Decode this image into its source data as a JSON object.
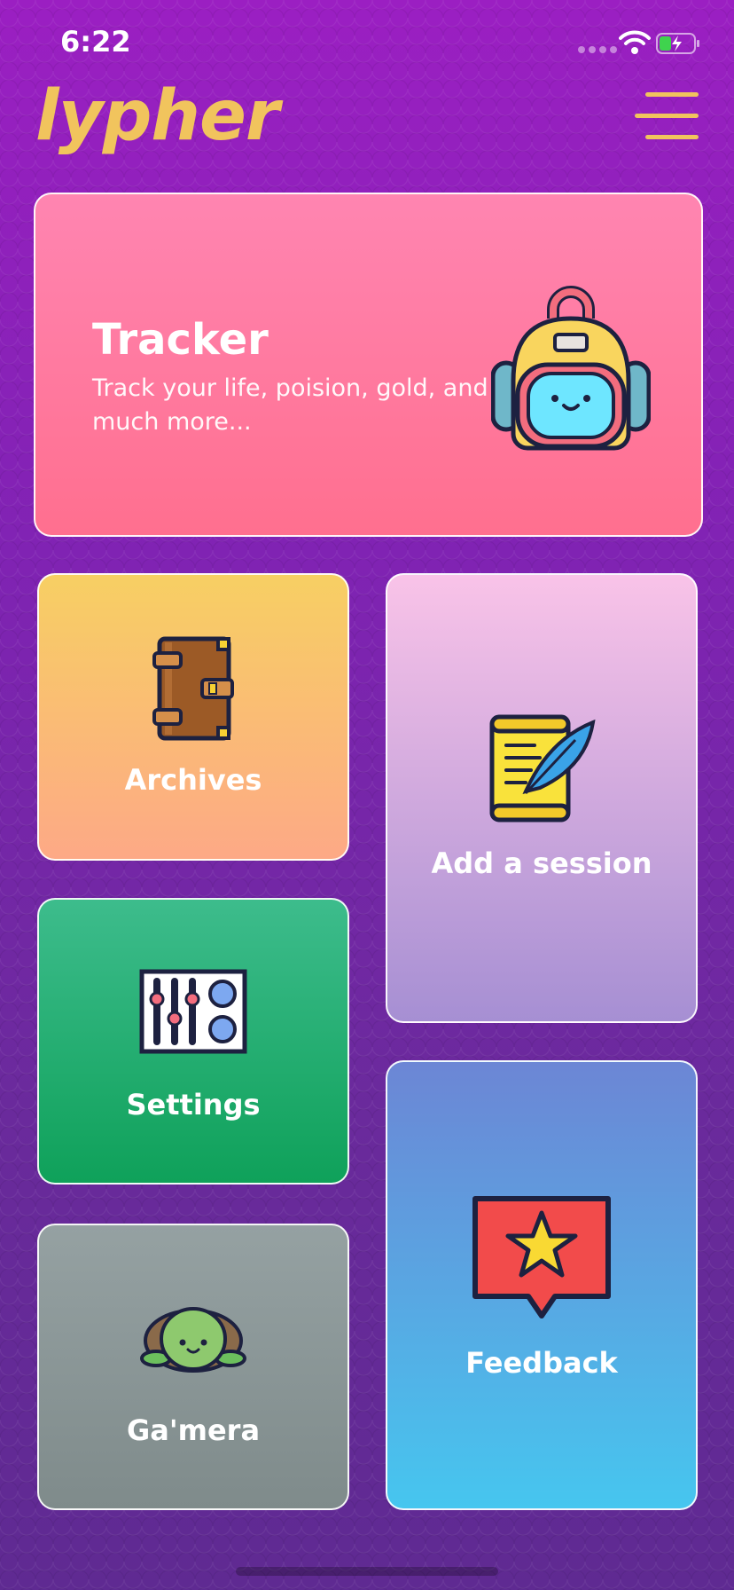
{
  "status_bar": {
    "time": "6:22"
  },
  "header": {
    "logo": "lypher"
  },
  "tracker": {
    "title": "Tracker",
    "description": "Track your life, poision, gold, and much more..."
  },
  "tiles": {
    "archives": "Archives",
    "add_session": "Add a session",
    "settings": "Settings",
    "feedback": "Feedback",
    "gamera": "Ga'mera"
  },
  "icons": {
    "menu": "hamburger-menu-icon",
    "tracker": "backpack-icon",
    "archives": "book-icon",
    "add_session": "scroll-quill-icon",
    "settings": "mixer-sliders-icon",
    "feedback": "star-speech-bubble-icon",
    "gamera": "turtle-icon"
  },
  "colors": {
    "logo": "#f1c45d",
    "tracker": "#ff7a9c",
    "archives": "#f9bd70",
    "add_session": "#c8a6dc",
    "settings": "#23ae70",
    "feedback": "#5aa6e3",
    "gamera": "#8a9596"
  }
}
